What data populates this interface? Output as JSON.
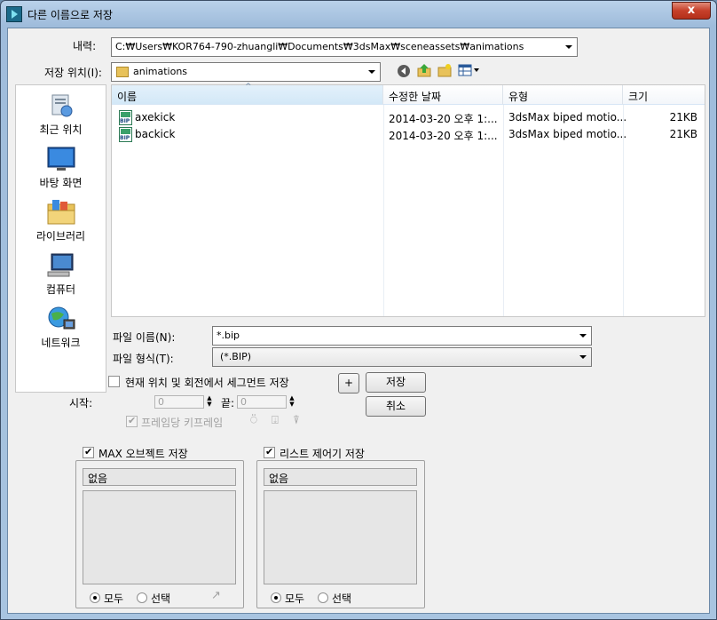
{
  "window": {
    "title": "다른 이름으로 저장",
    "close_label": "x"
  },
  "history": {
    "label": "내력:",
    "value": "C:₩Users₩KOR764-790-zhuangli₩Documents₩3dsMax₩sceneassets₩animations"
  },
  "location": {
    "label": "저장 위치(I):",
    "value": "animations"
  },
  "toolbar": {
    "icons": [
      "back-icon",
      "up-folder-icon",
      "new-folder-icon",
      "view-menu-icon"
    ]
  },
  "places": [
    {
      "label": "최근 위치",
      "icon": "recent-places-icon"
    },
    {
      "label": "바탕 화면",
      "icon": "desktop-icon"
    },
    {
      "label": "라이브러리",
      "icon": "libraries-icon"
    },
    {
      "label": "컴퓨터",
      "icon": "computer-icon"
    },
    {
      "label": "네트워크",
      "icon": "network-icon"
    }
  ],
  "file_list": {
    "columns": [
      "이름",
      "수정한 날짜",
      "유형",
      "크기"
    ],
    "rows": [
      {
        "name": "axekick",
        "date": "2014-03-20 오후 1:...",
        "type": "3dsMax biped motio...",
        "size": "21KB"
      },
      {
        "name": "backick",
        "date": "2014-03-20 오후 1:...",
        "type": "3dsMax biped motio...",
        "size": "21KB"
      }
    ]
  },
  "filename": {
    "label": "파일 이름(N):",
    "value": "*.bip"
  },
  "filetype": {
    "label": "파일 형식(T):",
    "value": "(*.BIP)"
  },
  "buttons": {
    "save": "저장",
    "cancel": "취소",
    "plus": "+"
  },
  "options": {
    "segment_label": "현재 위치 및 회전에서 세그먼트 저장",
    "start_label": "시작:",
    "start_value": "0",
    "end_label": "끝:",
    "end_value": "0",
    "per_frame_key_label": "프레임당 키프레임"
  },
  "max_objects": {
    "label": "MAX 오브젝트 저장",
    "header": "없음",
    "all_label": "모두",
    "select_label": "선택"
  },
  "list_controllers": {
    "label": "리스트 제어기 저장",
    "header": "없음",
    "all_label": "모두",
    "select_label": "선택"
  }
}
